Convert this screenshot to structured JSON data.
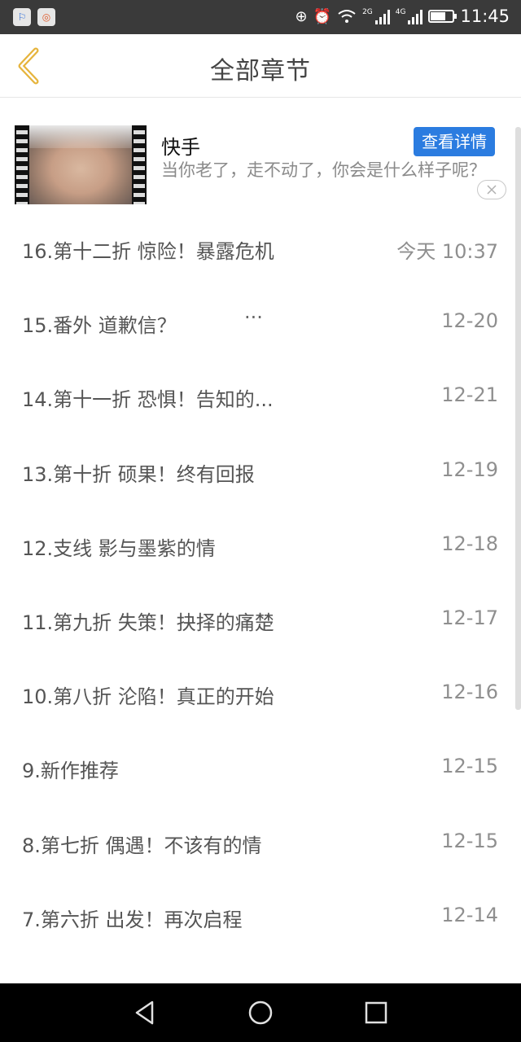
{
  "status_bar": {
    "app_icons": [
      "baidu-icon",
      "browser-icon"
    ],
    "app_icon_glyphs": [
      "⚐",
      "◎"
    ],
    "icons": [
      "hd-call-icon",
      "alarm-icon",
      "wifi-icon",
      "signal-2g-icon",
      "signal-4g-icon",
      "battery-icon"
    ],
    "network_2g": "2G",
    "network_4g": "4G",
    "battery_level": 0.7,
    "time": "11:45"
  },
  "header": {
    "title": "全部章节",
    "back_icon": "chevron-left-icon",
    "accent_color": "#e6b43c"
  },
  "ad": {
    "title": "快手",
    "description": "当你老了，走不动了，你会是什么样子呢？",
    "detail_button": "查看详情",
    "button_color": "#2b7ce0",
    "close_icon": "close-icon"
  },
  "chapters": [
    {
      "title": "16.第十二折 惊险！暴露危机",
      "date": "今天 10:37"
    },
    {
      "title": "15.番外 道歉信？",
      "date": "12-20",
      "extra": "···"
    },
    {
      "title": "14.第十一折 恐惧！告知的...",
      "date": "12-21"
    },
    {
      "title": "13.第十折 硕果！终有回报",
      "date": "12-19"
    },
    {
      "title": "12.支线 影与墨紫的情",
      "date": "12-18"
    },
    {
      "title": "11.第九折 失策！抉择的痛楚",
      "date": "12-17"
    },
    {
      "title": "10.第八折 沦陷！真正的开始",
      "date": "12-16"
    },
    {
      "title": "9.新作推荐",
      "date": "12-15"
    },
    {
      "title": "8.第七折 偶遇！不该有的情",
      "date": "12-15"
    },
    {
      "title": "7.第六折 出发！再次启程",
      "date": "12-14"
    }
  ],
  "nav_bar": {
    "icons": [
      "back-triangle-icon",
      "home-circle-icon",
      "recents-square-icon"
    ]
  }
}
